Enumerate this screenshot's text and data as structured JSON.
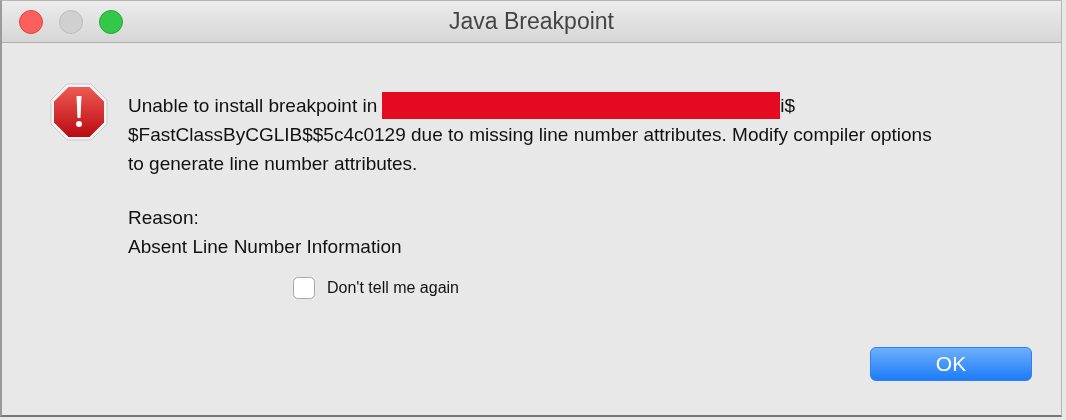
{
  "window": {
    "title": "Java Breakpoint"
  },
  "message": {
    "line_start": "Unable to install breakpoint in",
    "line_end": "i$",
    "rest": "$FastClassByCGLIB$$5c4c0129 due to missing line number attributes. Modify compiler options to generate line number attributes."
  },
  "reason": {
    "label": "Reason:",
    "text": "Absent Line Number Information"
  },
  "checkbox": {
    "label": "Don't tell me again",
    "checked": false
  },
  "buttons": [
    {
      "label": "OK",
      "kind": "default"
    }
  ]
}
